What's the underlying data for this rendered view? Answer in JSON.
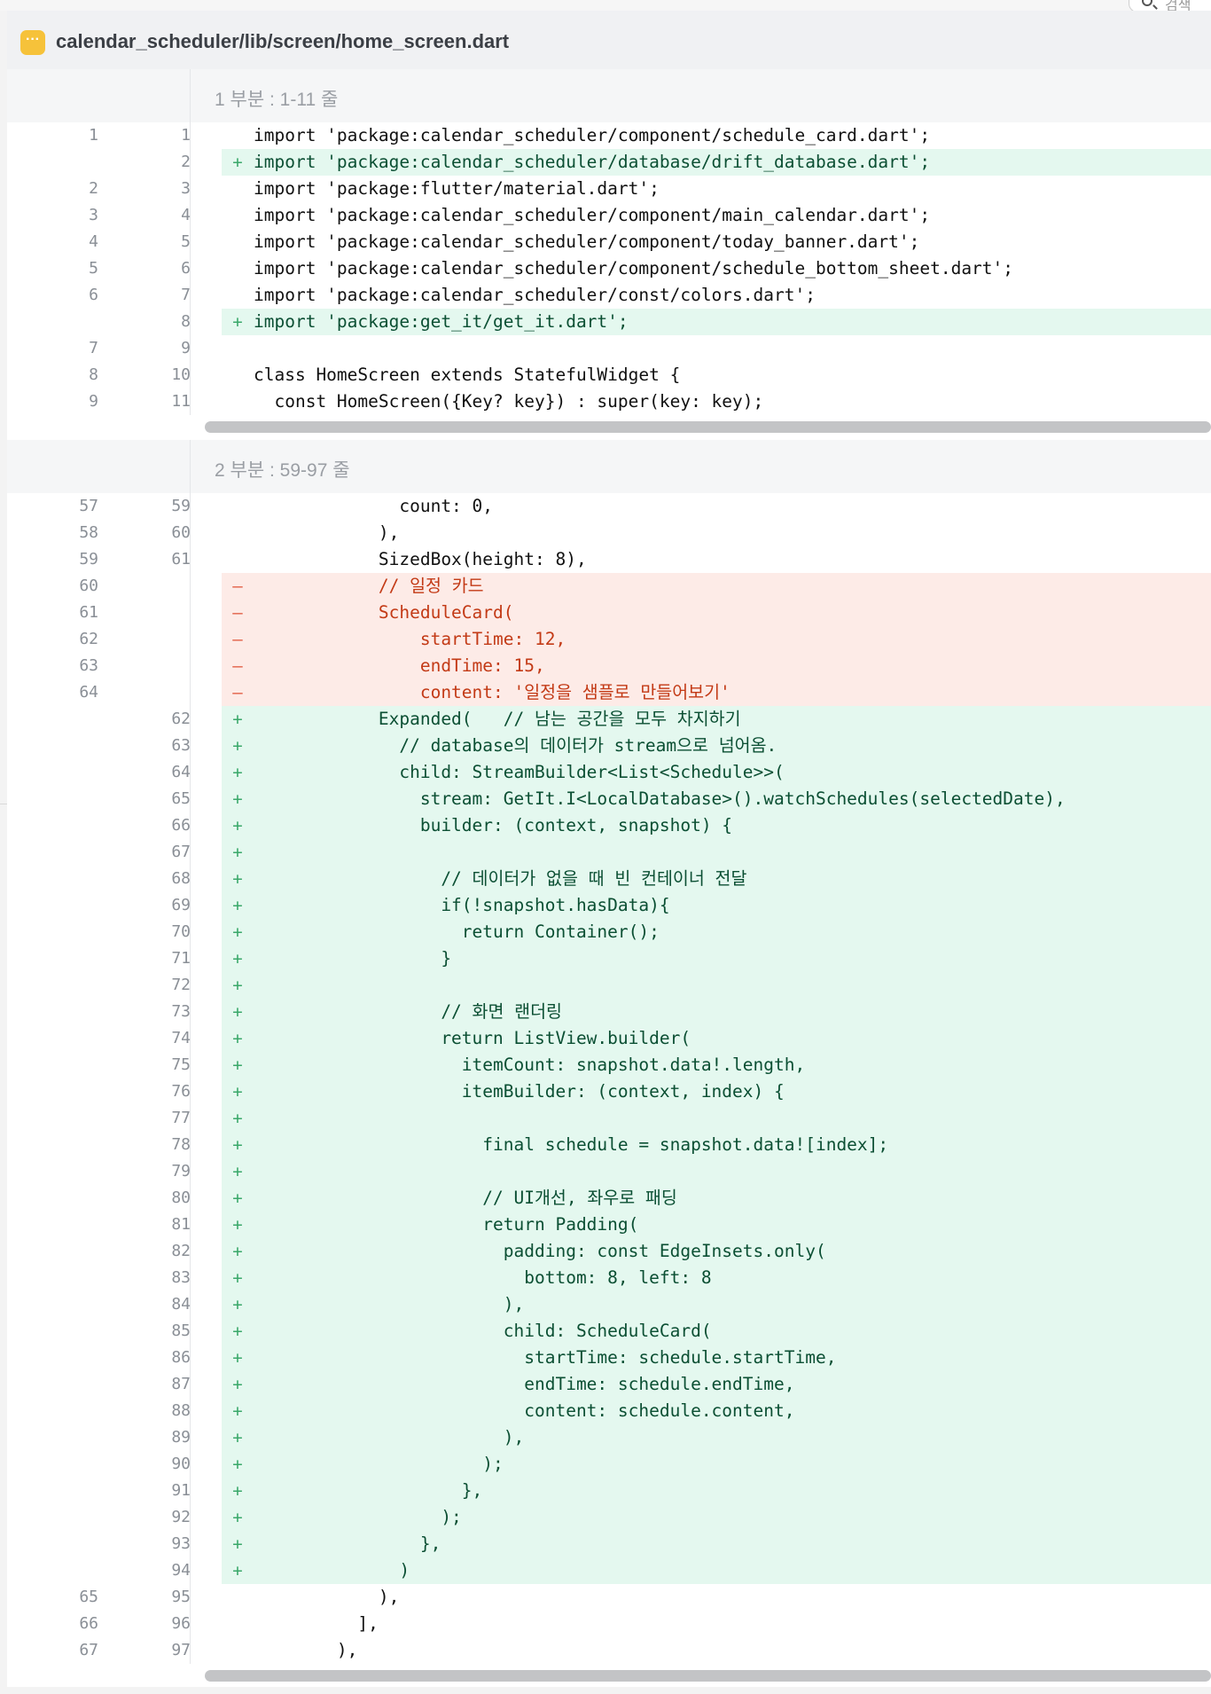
{
  "top_search": {
    "placeholder": "검색"
  },
  "file": {
    "path": "calendar_scheduler/lib/screen/home_screen.dart",
    "icon": "file-type-icon"
  },
  "hunks": [
    {
      "header": "1 부분 : 1-11 줄",
      "lines": [
        {
          "type": "ctx",
          "old": "1",
          "new": "1",
          "text": "import 'package:calendar_scheduler/component/schedule_card.dart';"
        },
        {
          "type": "add",
          "old": "",
          "new": "2",
          "text": "import 'package:calendar_scheduler/database/drift_database.dart';"
        },
        {
          "type": "ctx",
          "old": "2",
          "new": "3",
          "text": "import 'package:flutter/material.dart';"
        },
        {
          "type": "ctx",
          "old": "3",
          "new": "4",
          "text": "import 'package:calendar_scheduler/component/main_calendar.dart';"
        },
        {
          "type": "ctx",
          "old": "4",
          "new": "5",
          "text": "import 'package:calendar_scheduler/component/today_banner.dart';"
        },
        {
          "type": "ctx",
          "old": "5",
          "new": "6",
          "text": "import 'package:calendar_scheduler/component/schedule_bottom_sheet.dart';"
        },
        {
          "type": "ctx",
          "old": "6",
          "new": "7",
          "text": "import 'package:calendar_scheduler/const/colors.dart';"
        },
        {
          "type": "add",
          "old": "",
          "new": "8",
          "text": "import 'package:get_it/get_it.dart';"
        },
        {
          "type": "ctx",
          "old": "7",
          "new": "9",
          "text": ""
        },
        {
          "type": "ctx",
          "old": "8",
          "new": "10",
          "text": "class HomeScreen extends StatefulWidget {"
        },
        {
          "type": "ctx",
          "old": "9",
          "new": "11",
          "text": "  const HomeScreen({Key? key}) : super(key: key);"
        }
      ]
    },
    {
      "header": "2 부분 : 59-97 줄",
      "lines": [
        {
          "type": "ctx",
          "old": "57",
          "new": "59",
          "text": "              count: 0,"
        },
        {
          "type": "ctx",
          "old": "58",
          "new": "60",
          "text": "            ),"
        },
        {
          "type": "ctx",
          "old": "59",
          "new": "61",
          "text": "            SizedBox(height: 8),"
        },
        {
          "type": "del",
          "old": "60",
          "new": "",
          "text": "            // 일정 카드"
        },
        {
          "type": "del",
          "old": "61",
          "new": "",
          "text": "            ScheduleCard("
        },
        {
          "type": "del",
          "old": "62",
          "new": "",
          "text": "                startTime: 12,"
        },
        {
          "type": "del",
          "old": "63",
          "new": "",
          "text": "                endTime: 15,"
        },
        {
          "type": "del",
          "old": "64",
          "new": "",
          "text": "                content: '일정을 샘플로 만들어보기'"
        },
        {
          "type": "add",
          "old": "",
          "new": "62",
          "text": "            Expanded(   // 남는 공간을 모두 차지하기"
        },
        {
          "type": "add",
          "old": "",
          "new": "63",
          "text": "              // database의 데이터가 stream으로 넘어옴."
        },
        {
          "type": "add",
          "old": "",
          "new": "64",
          "text": "              child: StreamBuilder<List<Schedule>>("
        },
        {
          "type": "add",
          "old": "",
          "new": "65",
          "text": "                stream: GetIt.I<LocalDatabase>().watchSchedules(selectedDate),"
        },
        {
          "type": "add",
          "old": "",
          "new": "66",
          "text": "                builder: (context, snapshot) {"
        },
        {
          "type": "add",
          "old": "",
          "new": "67",
          "text": ""
        },
        {
          "type": "add",
          "old": "",
          "new": "68",
          "text": "                  // 데이터가 없을 때 빈 컨테이너 전달"
        },
        {
          "type": "add",
          "old": "",
          "new": "69",
          "text": "                  if(!snapshot.hasData){"
        },
        {
          "type": "add",
          "old": "",
          "new": "70",
          "text": "                    return Container();"
        },
        {
          "type": "add",
          "old": "",
          "new": "71",
          "text": "                  }"
        },
        {
          "type": "add",
          "old": "",
          "new": "72",
          "text": ""
        },
        {
          "type": "add",
          "old": "",
          "new": "73",
          "text": "                  // 화면 랜더링"
        },
        {
          "type": "add",
          "old": "",
          "new": "74",
          "text": "                  return ListView.builder("
        },
        {
          "type": "add",
          "old": "",
          "new": "75",
          "text": "                    itemCount: snapshot.data!.length,"
        },
        {
          "type": "add",
          "old": "",
          "new": "76",
          "text": "                    itemBuilder: (context, index) {"
        },
        {
          "type": "add",
          "old": "",
          "new": "77",
          "text": ""
        },
        {
          "type": "add",
          "old": "",
          "new": "78",
          "text": "                      final schedule = snapshot.data![index];"
        },
        {
          "type": "add",
          "old": "",
          "new": "79",
          "text": ""
        },
        {
          "type": "add",
          "old": "",
          "new": "80",
          "text": "                      // UI개선, 좌우로 패딩"
        },
        {
          "type": "add",
          "old": "",
          "new": "81",
          "text": "                      return Padding("
        },
        {
          "type": "add",
          "old": "",
          "new": "82",
          "text": "                        padding: const EdgeInsets.only("
        },
        {
          "type": "add",
          "old": "",
          "new": "83",
          "text": "                          bottom: 8, left: 8"
        },
        {
          "type": "add",
          "old": "",
          "new": "84",
          "text": "                        ),"
        },
        {
          "type": "add",
          "old": "",
          "new": "85",
          "text": "                        child: ScheduleCard("
        },
        {
          "type": "add",
          "old": "",
          "new": "86",
          "text": "                          startTime: schedule.startTime,"
        },
        {
          "type": "add",
          "old": "",
          "new": "87",
          "text": "                          endTime: schedule.endTime,"
        },
        {
          "type": "add",
          "old": "",
          "new": "88",
          "text": "                          content: schedule.content,"
        },
        {
          "type": "add",
          "old": "",
          "new": "89",
          "text": "                        ),"
        },
        {
          "type": "add",
          "old": "",
          "new": "90",
          "text": "                      );"
        },
        {
          "type": "add",
          "old": "",
          "new": "91",
          "text": "                    },"
        },
        {
          "type": "add",
          "old": "",
          "new": "92",
          "text": "                  );"
        },
        {
          "type": "add",
          "old": "",
          "new": "93",
          "text": "                },"
        },
        {
          "type": "add",
          "old": "",
          "new": "94",
          "text": "              )"
        },
        {
          "type": "ctx",
          "old": "65",
          "new": "95",
          "text": "            ),"
        },
        {
          "type": "ctx",
          "old": "66",
          "new": "96",
          "text": "          ],"
        },
        {
          "type": "ctx",
          "old": "67",
          "new": "97",
          "text": "        ),"
        }
      ]
    }
  ],
  "colors": {
    "added_bg": "#e4f8ef",
    "removed_bg": "#fdebe7",
    "added_text": "#0b4f33",
    "removed_text": "#c33a16",
    "icon": "#f6c23a"
  }
}
